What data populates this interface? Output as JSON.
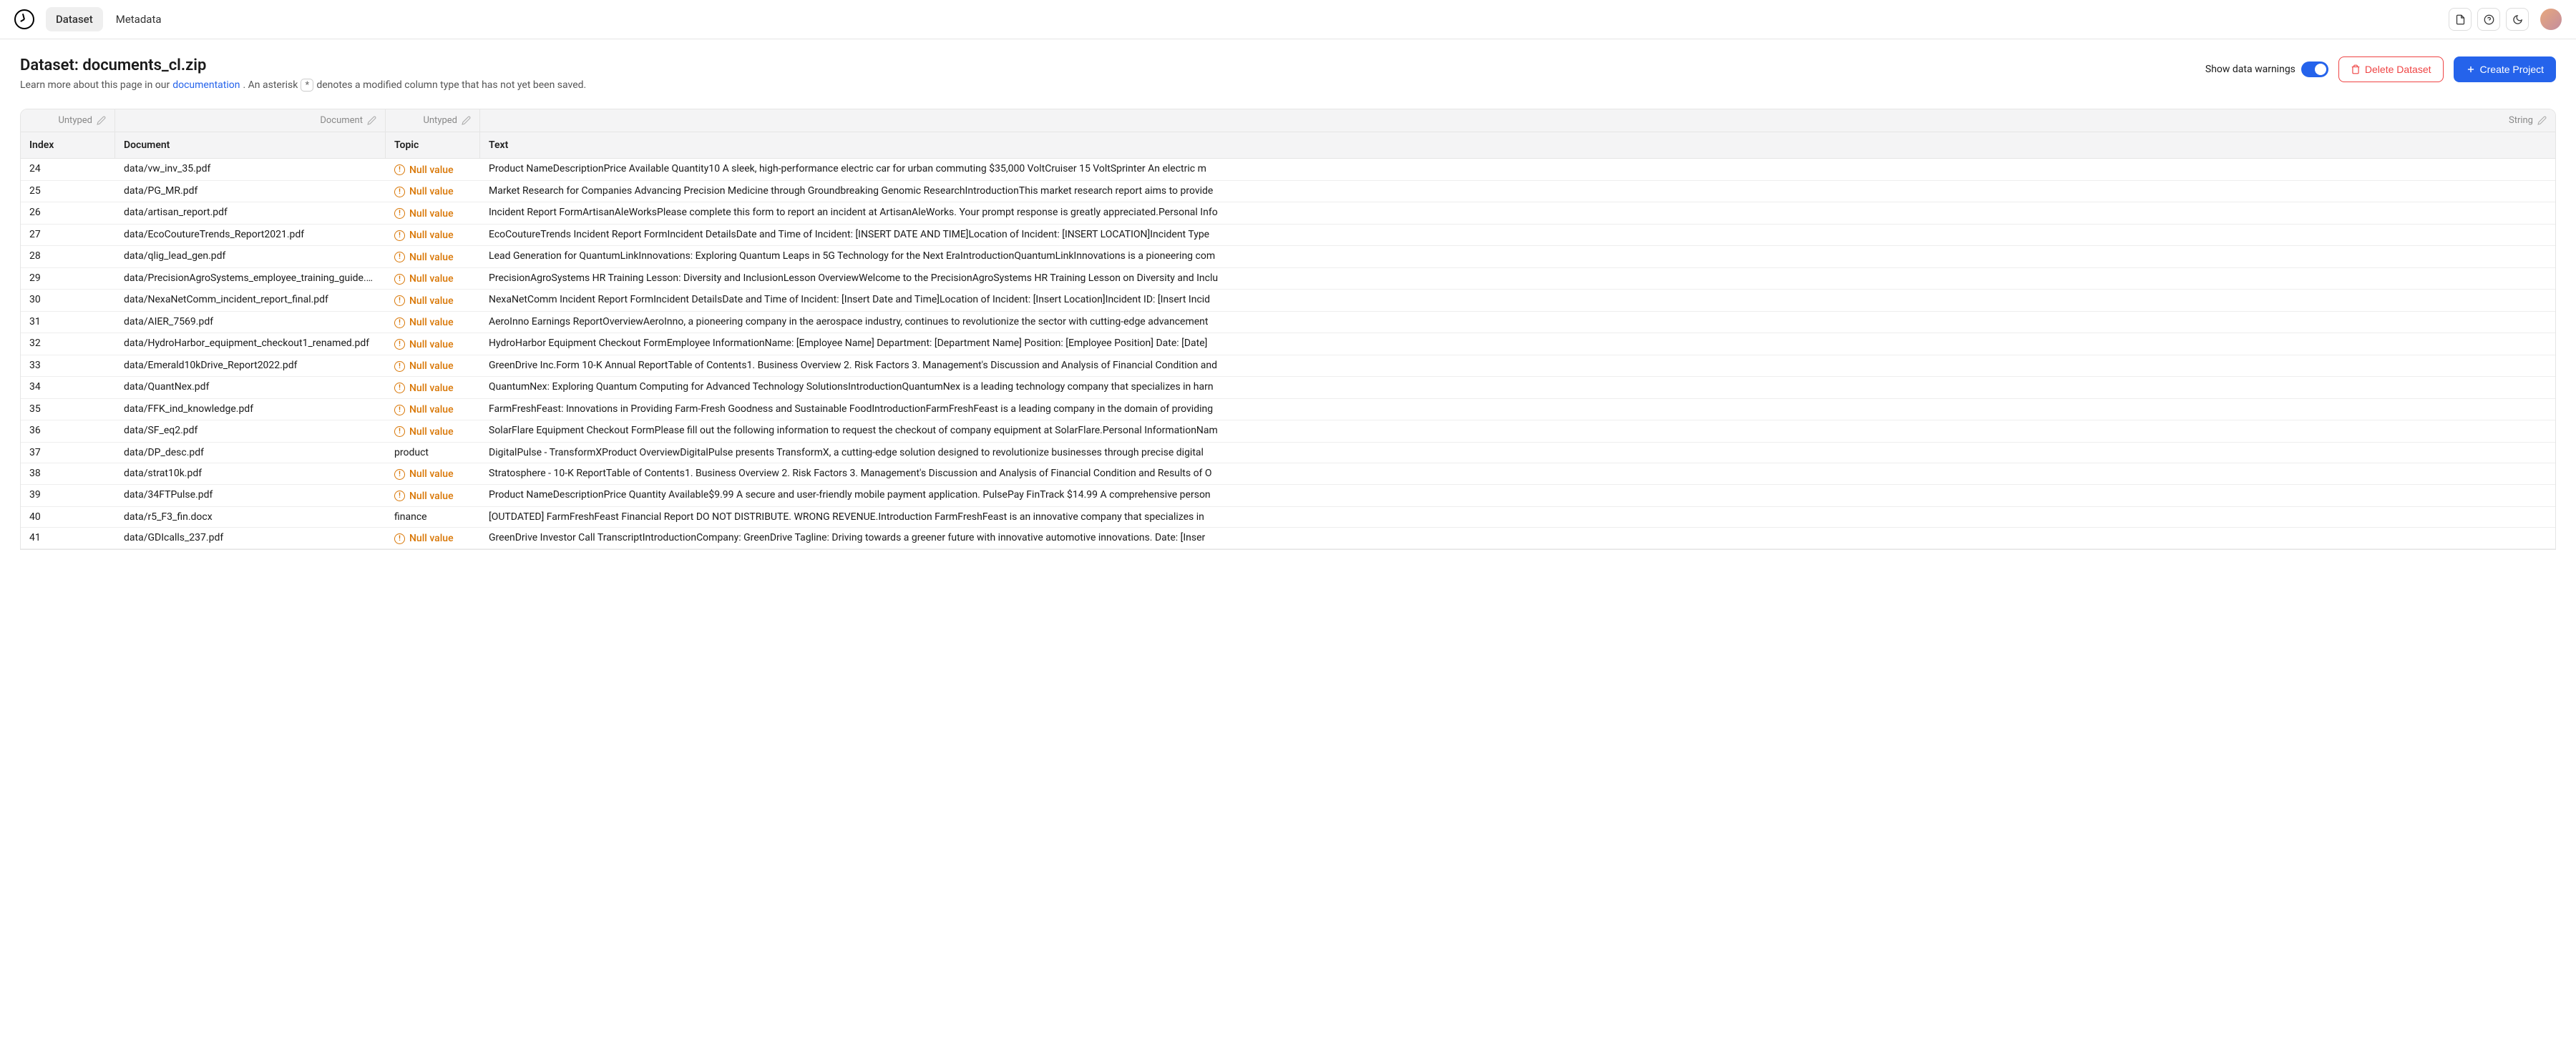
{
  "nav": {
    "tabs": [
      "Dataset",
      "Metadata"
    ],
    "active_tab": 0
  },
  "header": {
    "title_prefix": "Dataset: ",
    "title_name": "documents_cl.zip",
    "subtitle_pre": "Learn more about this page in our ",
    "subtitle_link": "documentation",
    "subtitle_mid": ". An asterisk ",
    "asterisk": "*",
    "subtitle_post": " denotes a modified column type that has not yet been saved."
  },
  "controls": {
    "show_warnings_label": "Show data warnings",
    "delete_label": "Delete Dataset",
    "create_label": "Create Project"
  },
  "columns": {
    "types": [
      "Untyped",
      "Document",
      "Untyped",
      "String"
    ],
    "names": [
      "Index",
      "Document",
      "Topic",
      "Text"
    ]
  },
  "null_label": "Null value",
  "rows": [
    {
      "index": "24",
      "document": "data/vw_inv_35.pdf",
      "topic": null,
      "text": "Product NameDescriptionPrice Available Quantity10 A sleek, high-performance electric car for urban commuting $35,000 VoltCruiser 15 VoltSprinter An electric m"
    },
    {
      "index": "25",
      "document": "data/PG_MR.pdf",
      "topic": null,
      "text": "Market Research for Companies Advancing Precision Medicine through Groundbreaking Genomic ResearchIntroductionThis market research report aims to provide"
    },
    {
      "index": "26",
      "document": "data/artisan_report.pdf",
      "topic": null,
      "text": "Incident Report FormArtisanAleWorksPlease complete this form to report an incident at ArtisanAleWorks. Your prompt response is greatly appreciated.Personal Info"
    },
    {
      "index": "27",
      "document": "data/EcoCoutureTrends_Report2021.pdf",
      "topic": null,
      "text": "EcoCoutureTrends Incident Report FormIncident DetailsDate and Time of Incident: [INSERT DATE AND TIME]Location of Incident: [INSERT LOCATION]Incident Type"
    },
    {
      "index": "28",
      "document": "data/qlig_lead_gen.pdf",
      "topic": null,
      "text": "Lead Generation for QuantumLinkInnovations: Exploring Quantum Leaps in 5G Technology for the Next EraIntroductionQuantumLinkInnovations is a pioneering com"
    },
    {
      "index": "29",
      "document": "data/PrecisionAgroSystems_employee_training_guide.pdf",
      "topic": null,
      "text": "PrecisionAgroSystems HR Training Lesson: Diversity and InclusionLesson OverviewWelcome to the PrecisionAgroSystems HR Training Lesson on Diversity and Inclu"
    },
    {
      "index": "30",
      "document": "data/NexaNetComm_incident_report_final.pdf",
      "topic": null,
      "text": "NexaNetComm Incident Report FormIncident DetailsDate and Time of Incident: [Insert Date and Time]Location of Incident: [Insert Location]Incident ID: [Insert Incid"
    },
    {
      "index": "31",
      "document": "data/AIER_7569.pdf",
      "topic": null,
      "text": "AeroInno Earnings ReportOverviewAeroInno, a pioneering company in the aerospace industry, continues to revolutionize the sector with cutting-edge advancement"
    },
    {
      "index": "32",
      "document": "data/HydroHarbor_equipment_checkout1_renamed.pdf",
      "topic": null,
      "text": "HydroHarbor Equipment Checkout FormEmployee InformationName: [Employee Name] Department: [Department Name] Position: [Employee Position] Date: [Date]"
    },
    {
      "index": "33",
      "document": "data/Emerald10kDrive_Report2022.pdf",
      "topic": null,
      "text": "GreenDrive Inc.Form 10-K Annual ReportTable of Contents1. Business Overview 2. Risk Factors 3. Management's Discussion and Analysis of Financial Condition and"
    },
    {
      "index": "34",
      "document": "data/QuantNex.pdf",
      "topic": null,
      "text": "QuantumNex: Exploring Quantum Computing for Advanced Technology SolutionsIntroductionQuantumNex is a leading technology company that specializes in harn"
    },
    {
      "index": "35",
      "document": "data/FFK_ind_knowledge.pdf",
      "topic": null,
      "text": "FarmFreshFeast: Innovations in Providing Farm-Fresh Goodness and Sustainable FoodIntroductionFarmFreshFeast is a leading company in the domain of providing"
    },
    {
      "index": "36",
      "document": "data/SF_eq2.pdf",
      "topic": null,
      "text": "SolarFlare Equipment Checkout FormPlease fill out the following information to request the checkout of company equipment at SolarFlare.Personal InformationNam"
    },
    {
      "index": "37",
      "document": "data/DP_desc.pdf",
      "topic": "product",
      "text": "DigitalPulse - TransformXProduct OverviewDigitalPulse presents TransformX, a cutting-edge solution designed to revolutionize businesses through precise digital"
    },
    {
      "index": "38",
      "document": "data/strat10k.pdf",
      "topic": null,
      "text": "Stratosphere - 10-K ReportTable of Contents1. Business Overview 2. Risk Factors 3. Management's Discussion and Analysis of Financial Condition and Results of O"
    },
    {
      "index": "39",
      "document": "data/34FTPulse.pdf",
      "topic": null,
      "text": "Product NameDescriptionPrice Quantity Available$9.99 A secure and user-friendly mobile payment application. PulsePay FinTrack $14.99 A comprehensive person"
    },
    {
      "index": "40",
      "document": "data/r5_F3_fin.docx",
      "topic": "finance",
      "text": "[OUTDATED] FarmFreshFeast Financial Report DO NOT DISTRIBUTE. WRONG REVENUE.Introduction FarmFreshFeast is an innovative company that specializes in"
    },
    {
      "index": "41",
      "document": "data/GDIcalls_237.pdf",
      "topic": null,
      "text": "GreenDrive Investor Call TranscriptIntroductionCompany: GreenDrive Tagline: Driving towards a greener future with innovative automotive innovations. Date: [Inser"
    }
  ]
}
